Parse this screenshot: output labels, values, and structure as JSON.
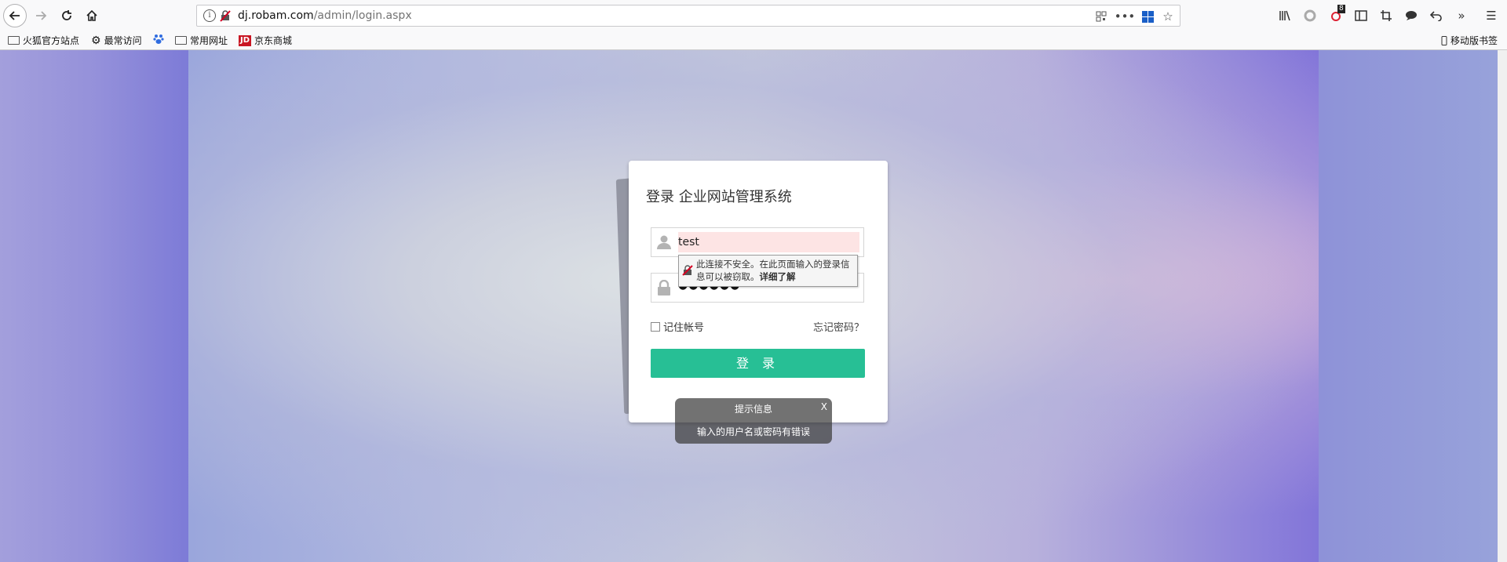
{
  "browser": {
    "url_host": "dj.robam.com",
    "url_path": "/admin/login.aspx",
    "badge_count": "8"
  },
  "bookmarks": [
    {
      "label": "火狐官方站点"
    },
    {
      "label": "最常访问"
    },
    {
      "label": "常用网址"
    },
    {
      "label": "京东商城"
    }
  ],
  "mobile_bookmarks": "移动版书签",
  "login": {
    "title": "登录 企业网站管理系统",
    "username_value": "test",
    "password_mask": "●●●●●●",
    "remember_label": "记住帐号",
    "forgot_label": "忘记密码？",
    "submit_label": "登 录"
  },
  "insecure_tip": {
    "text": "此连接不安全。在此页面输入的登录信息可以被窃取。",
    "link": "详细了解"
  },
  "toast": {
    "title": "提示信息",
    "close": "X",
    "message": "输入的用户名或密码有错误"
  },
  "colors": {
    "primary_button": "#27bf95",
    "username_error_bg": "#fde4e4"
  }
}
